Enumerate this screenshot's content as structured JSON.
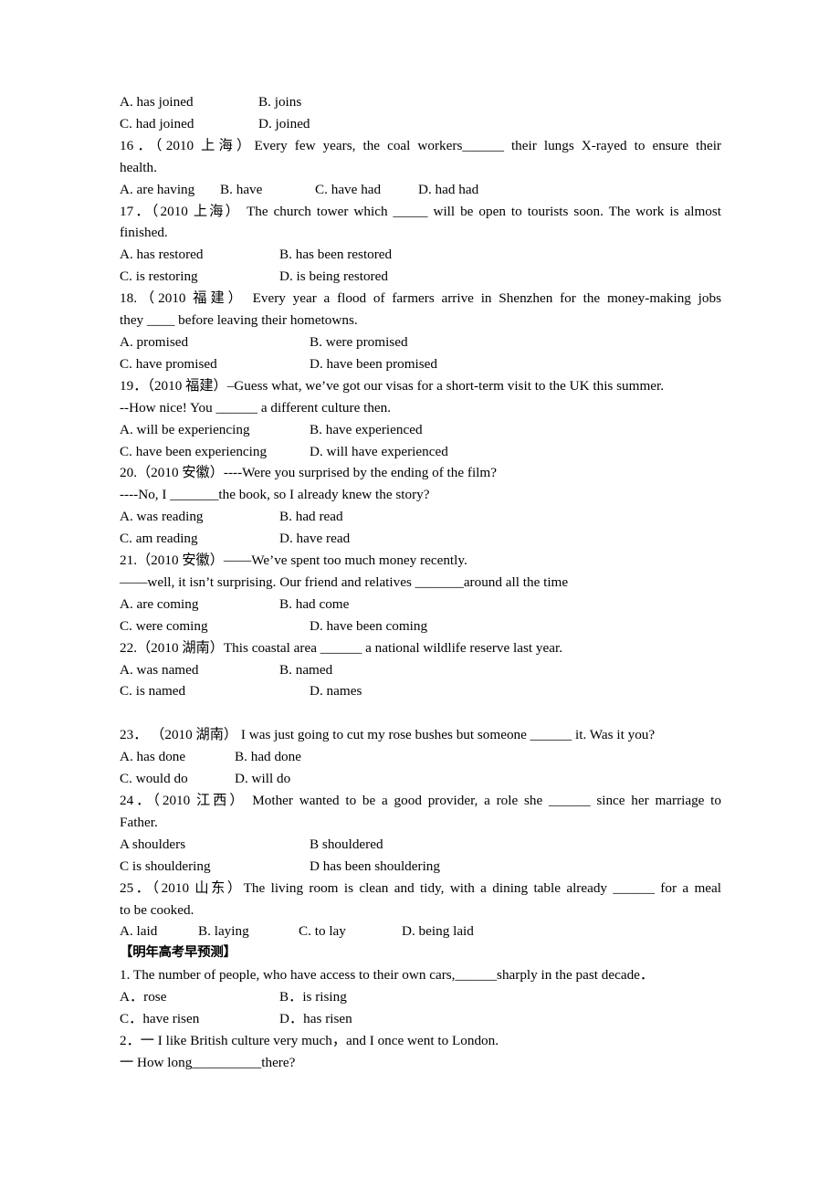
{
  "document": {
    "type": "english-grammar-exercise-worksheet",
    "language": "en-zh"
  },
  "questions": [
    {
      "id": "q15-options",
      "options_row1": [
        "A. has joined",
        "B. joins"
      ],
      "options_row2": [
        "C. had joined",
        "D. joined"
      ]
    },
    {
      "id": "q16",
      "number": "16．",
      "source": "（2010 上海）",
      "stem_line1": "16．（2010 上海）Every few years, the coal workers______ their lungs X-rayed to ensure their",
      "stem_line2": "health.",
      "options": [
        "A. are having",
        "B. have",
        "C. have had",
        "D. had had"
      ]
    },
    {
      "id": "q17",
      "number": "17．",
      "source": "（2010 上海）",
      "stem_line1": "17．（2010 上海） The church tower which _____ will be open to tourists soon. The work is almost",
      "stem_line2": "finished.",
      "options_row1": [
        "A. has restored",
        "B. has been restored"
      ],
      "options_row2": [
        "C. is restoring",
        "D. is being restored"
      ]
    },
    {
      "id": "q18",
      "number": "18.",
      "source": "（2010 福建）",
      "stem_line1": "18.（2010 福建） Every year a flood of farmers arrive in Shenzhen for the money-making jobs",
      "stem_line2": "they ____ before leaving their hometowns.",
      "options_row1": [
        "A. promised",
        "B. were promised"
      ],
      "options_row2": [
        "C. have promised",
        "D. have been promised"
      ]
    },
    {
      "id": "q19",
      "number": "19．",
      "source": "（2010 福建）",
      "stem_line1": "19．（2010 福建）–Guess what, we’ve got our visas for a short-term visit to the UK this summer.",
      "stem_line2": "--How nice! You ______ a different culture then.",
      "options_row1": [
        "A. will be experiencing",
        "B. have experienced"
      ],
      "options_row2": [
        "C. have been experiencing",
        "D. will have experienced"
      ]
    },
    {
      "id": "q20",
      "number": "20.",
      "source": "（2010 安徽）",
      "stem_line1": "20.（2010 安徽）----Were you surprised by the ending of the film?",
      "stem_line2": "----No, I _______the book, so I already knew the story?",
      "options_row1": [
        "A. was reading",
        "B. had read"
      ],
      "options_row2": [
        "C. am reading",
        "D. have read"
      ]
    },
    {
      "id": "q21",
      "number": "21.",
      "source": "（2010 安徽）",
      "stem_line1": "21.（2010 安徽）——We’ve spent too much money recently.",
      "stem_line2": "——well, it isn’t surprising. Our friend and relatives _______around all the time",
      "options_row1": [
        "A. are coming",
        "B. had come"
      ],
      "options_row2": [
        "C. were coming",
        "D. have been coming"
      ]
    },
    {
      "id": "q22",
      "number": "22.",
      "source": "（2010 湖南）",
      "stem_line1": "22.（2010 湖南）This coastal area ______ a national wildlife reserve last year.",
      "options_row1": [
        "A. was named",
        "B. named"
      ],
      "options_row2": [
        "C. is named",
        "D. names"
      ]
    },
    {
      "id": "q23",
      "number": "23．",
      "source": "（2010 湖南）",
      "stem_line1": "23． （2010 湖南） I was just going to cut my rose bushes but someone ______ it. Was it you?",
      "options_row1": [
        "A. has done",
        "B. had done"
      ],
      "options_row2": [
        "C. would do",
        "D. will do"
      ]
    },
    {
      "id": "q24",
      "number": "24．",
      "source": "（2010 江西）",
      "stem_line1": "24．（2010 江西） Mother wanted to be a good provider, a role she ______ since her marriage to",
      "stem_line2": "Father.",
      "options_row1": [
        "A shoulders",
        "B shouldered"
      ],
      "options_row2": [
        "C is shouldering",
        "D has been shouldering"
      ]
    },
    {
      "id": "q25",
      "number": "25．",
      "source": "（2010 山东）",
      "stem_line1": "25．（2010 山东）The living room is clean and tidy, with a dining table already ______ for a meal",
      "stem_line2": "to be cooked.",
      "options": [
        "A. laid",
        "B. laying",
        "C. to lay",
        "D. being laid"
      ]
    }
  ],
  "prediction_section": {
    "heading": "【明年高考早预测】",
    "questions": [
      {
        "id": "p1",
        "stem_line1": "1. The number of people, who have access to their own cars,______sharply in the past decade．",
        "options_row1": [
          "A．rose",
          "B．is rising"
        ],
        "options_row2": [
          "C．have risen",
          "D．has risen"
        ]
      },
      {
        "id": "p2",
        "stem_line1": "2．一 I like British culture very much，and I once went to London.",
        "stem_line2": "一 How long__________there?"
      }
    ]
  }
}
